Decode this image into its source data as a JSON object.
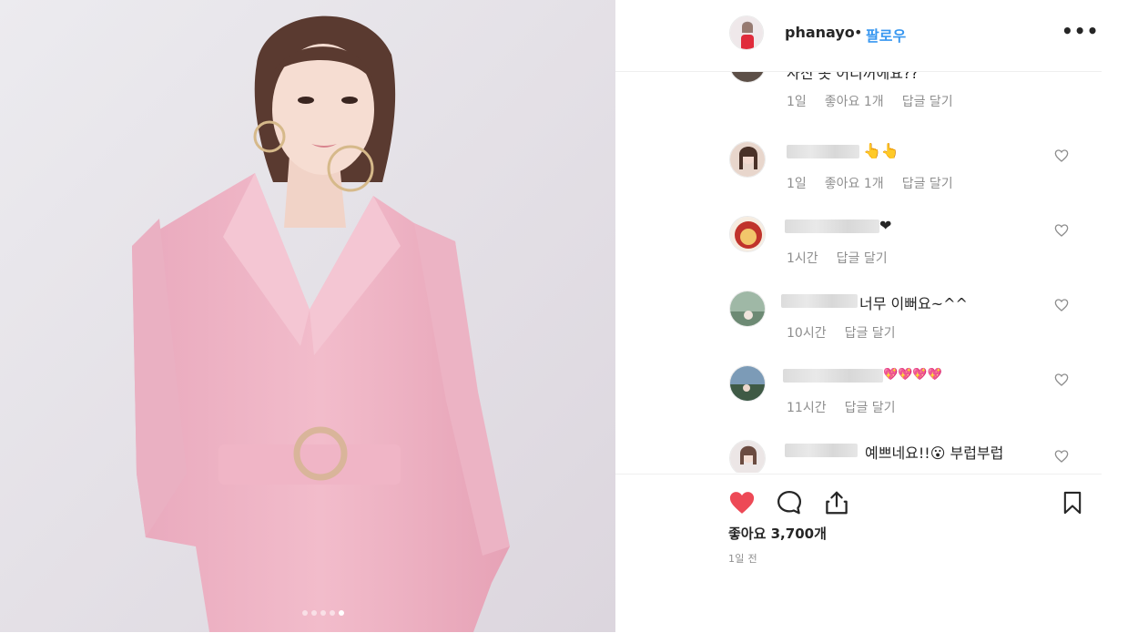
{
  "post": {
    "author": {
      "username": "phanayo",
      "separator": "•",
      "follow_label": "팔로우"
    },
    "more_icon": "more-options-icon",
    "carousel": {
      "count": 5,
      "active_index": 4
    }
  },
  "comments": [
    {
      "text": "사진 옷 어디꺼에요??",
      "time": "1일",
      "likes": "좋아요 1개",
      "reply": "답글 달기"
    },
    {
      "text": "👆👆",
      "time": "1일",
      "likes": "좋아요 1개",
      "reply": "답글 달기"
    },
    {
      "text": "❤",
      "time": "1시간",
      "likes": "",
      "reply": "답글 달기"
    },
    {
      "text": "너무 이뻐요~^^",
      "time": "10시간",
      "likes": "",
      "reply": "답글 달기"
    },
    {
      "text": "💖💖💖💖",
      "time": "11시간",
      "likes": "",
      "reply": "답글 달기"
    },
    {
      "text": "예쁘네요!!😮 부럽부럽",
      "time": "",
      "likes": "",
      "reply": ""
    }
  ],
  "actions": {
    "like_icon": "heart-filled-icon",
    "comment_icon": "comment-icon",
    "share_icon": "share-icon",
    "save_icon": "bookmark-icon",
    "likes_count": "좋아요 3,700개",
    "posted": "1일 전"
  },
  "colors": {
    "accent": "#3897f0",
    "like": "#ed4956",
    "muted": "#8e8e8e"
  }
}
